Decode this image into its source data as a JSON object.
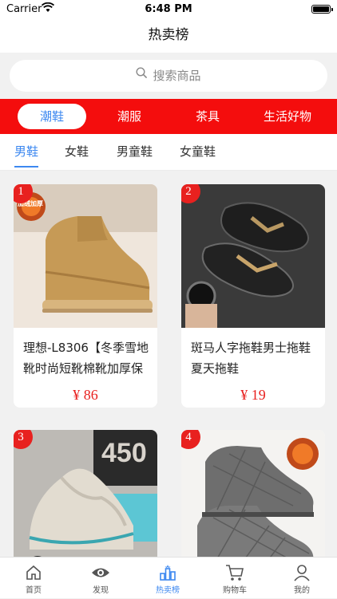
{
  "status_bar": {
    "carrier": "Carrier",
    "time": "6:48 PM"
  },
  "nav": {
    "title": "热卖榜"
  },
  "search": {
    "placeholder": "搜索商品"
  },
  "categories": [
    {
      "label": "潮鞋",
      "active": true
    },
    {
      "label": "潮服",
      "active": false
    },
    {
      "label": "茶具",
      "active": false
    },
    {
      "label": "生活好物",
      "active": false
    }
  ],
  "subtabs": [
    {
      "label": "男鞋",
      "active": true
    },
    {
      "label": "女鞋",
      "active": false
    },
    {
      "label": "男童鞋",
      "active": false
    },
    {
      "label": "女童鞋",
      "active": false
    }
  ],
  "products": [
    {
      "rank": "1",
      "title": "理想-L8306【冬季雪地靴时尚短靴棉靴加厚保",
      "price": "¥ 86",
      "image": "tan-high-top-sneaker"
    },
    {
      "rank": "2",
      "title": "斑马人字拖鞋男士拖鞋夏天拖鞋",
      "price": "¥ 19",
      "image": "black-flip-flop-sandal"
    },
    {
      "rank": "3",
      "title": "",
      "price": "",
      "image": "beige-knit-sneaker"
    },
    {
      "rank": "4",
      "title": "",
      "price": "",
      "image": "gray-quilted-boot"
    }
  ],
  "badges": {
    "hot_badge_text": "加绒加厚"
  },
  "tabbar": [
    {
      "label": "首页",
      "icon": "home-icon",
      "active": false
    },
    {
      "label": "发现",
      "icon": "eye-icon",
      "active": false
    },
    {
      "label": "热卖榜",
      "icon": "ranking-icon",
      "active": true
    },
    {
      "label": "购物车",
      "icon": "cart-icon",
      "active": false
    },
    {
      "label": "我的",
      "icon": "user-icon",
      "active": false
    }
  ],
  "colors": {
    "accent": "#3d88f0",
    "brand_red": "#f40d0d",
    "price_red": "#e8211f"
  }
}
